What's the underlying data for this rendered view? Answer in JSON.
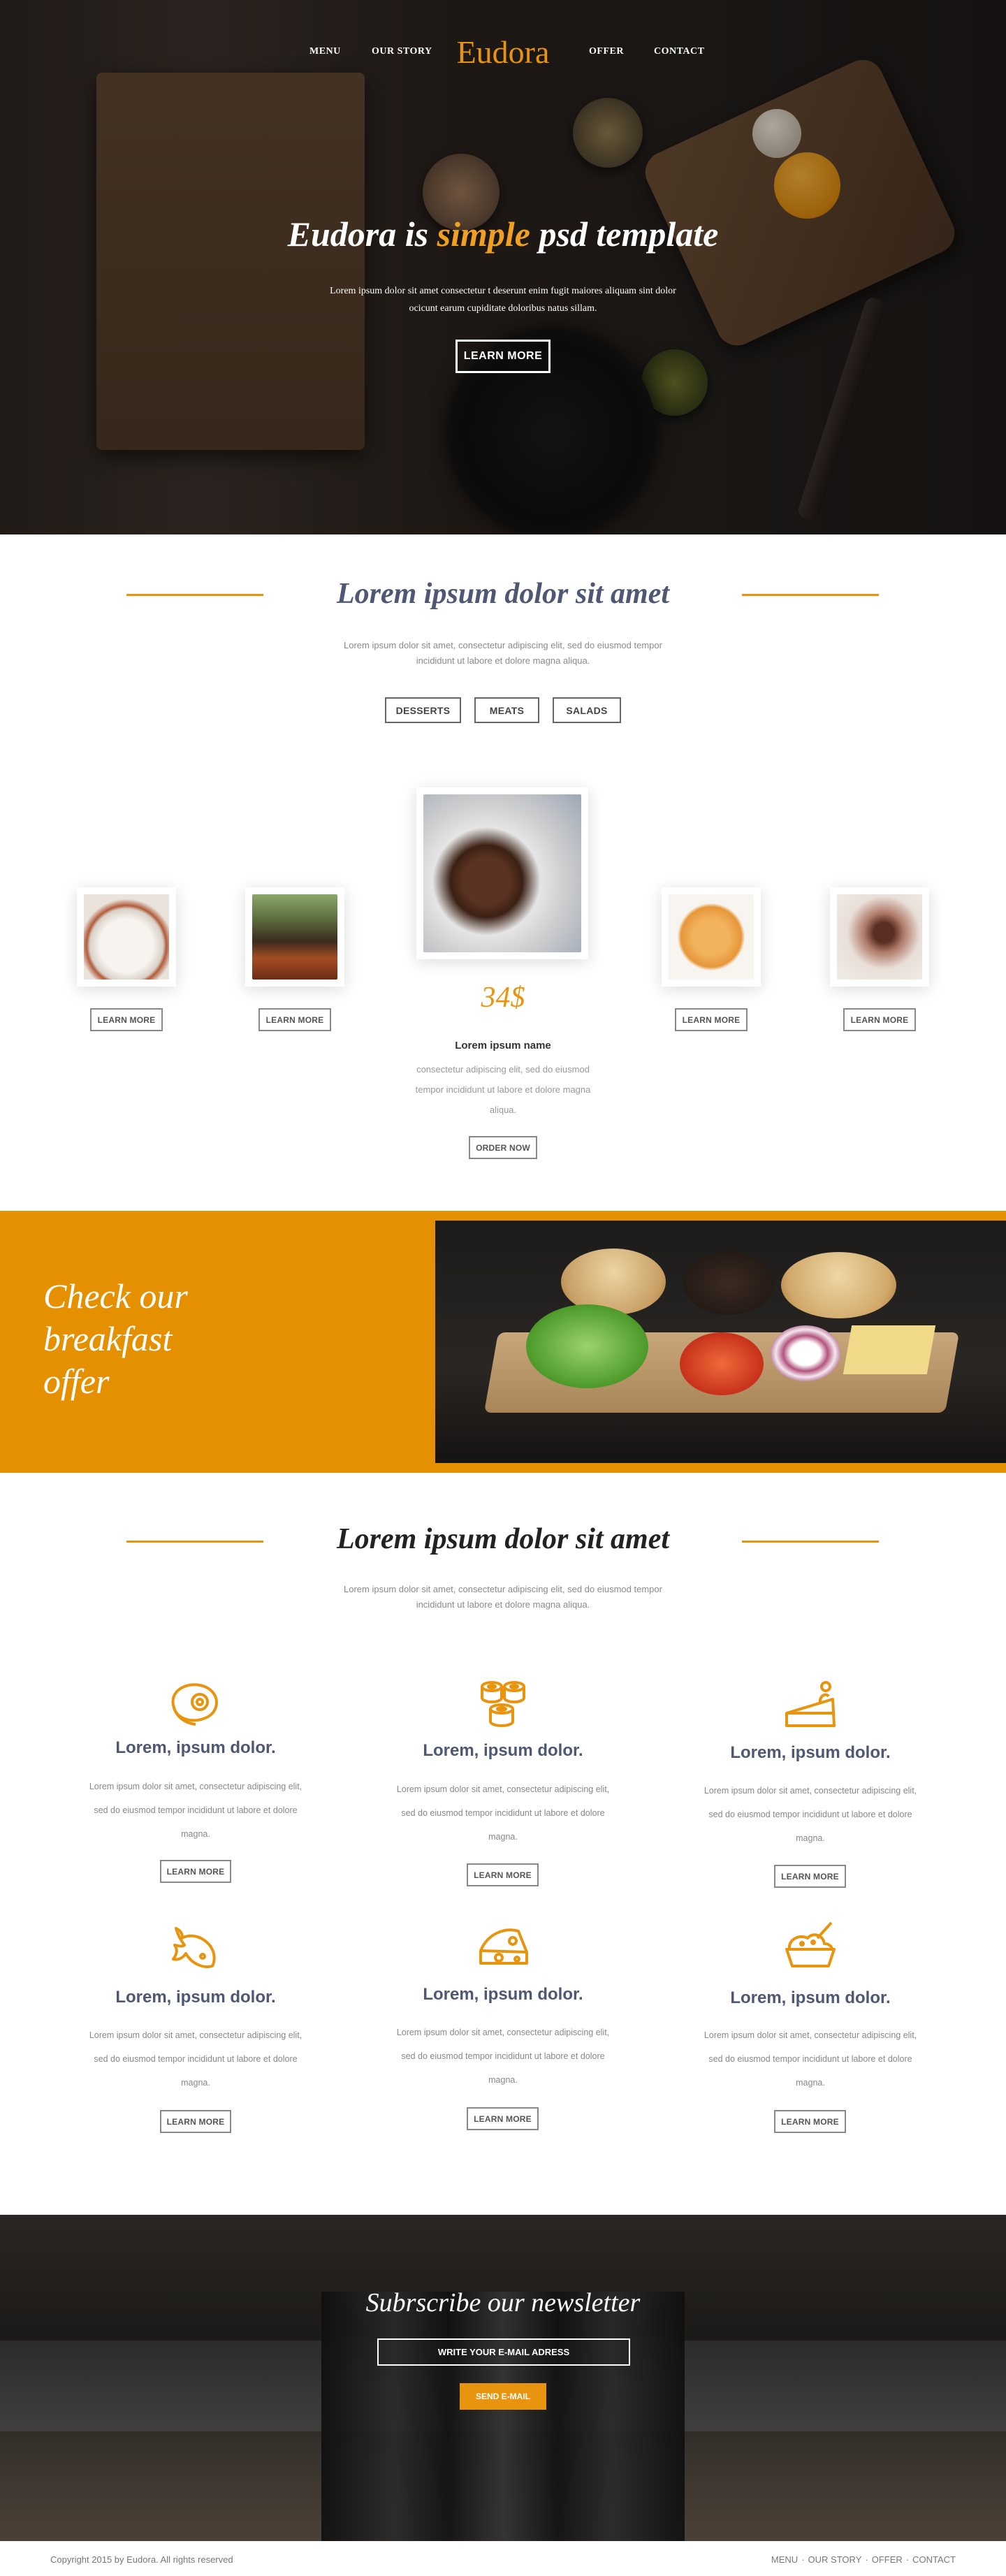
{
  "nav": {
    "menu": "MENU",
    "our_story": "OUR STORY",
    "logo": "Eudora",
    "offer": "OFFER",
    "contact": "CONTACT"
  },
  "hero": {
    "title_before": "Eudora is ",
    "title_highlight": "simple",
    "title_after": " psd template",
    "description": "Lorem ipsum dolor sit amet consectetur t deserunt enim fugit maiores aliquam sint dolor ocicunt earum cupiditate doloribus natus sillam.",
    "button": "LEARN MORE"
  },
  "section1": {
    "title": "Lorem ipsum dolor sit amet",
    "description": "Lorem ipsum dolor sit amet, consectetur adipiscing elit, sed do eiusmod tempor incididunt ut labore et dolore magna aliqua.",
    "tabs": [
      "DESSERTS",
      "MEATS",
      "SALADS"
    ],
    "card_button": "LEARN MORE",
    "featured": {
      "price": "34$",
      "name": "Lorem ipsum name",
      "description": "consectetur adipiscing elit, sed do eiusmod tempor incididunt ut labore et dolore magna aliqua.",
      "button": "ORDER NOW"
    }
  },
  "breakfast": {
    "text": "Check our breakfast offer"
  },
  "section2": {
    "title": "Lorem ipsum dolor sit amet",
    "description": "Lorem ipsum dolor sit amet, consectetur adipiscing elit, sed do eiusmod tempor incididunt ut labore et dolore magna aliqua.",
    "feature_title": "Lorem, ipsum dolor.",
    "feature_desc": "Lorem ipsum dolor sit amet, consectetur adipiscing elit, sed do eiusmod tempor incididunt ut labore et dolore magna.",
    "button": "LEARN MORE",
    "icons": [
      "steak-icon",
      "sushi-icon",
      "cake-icon",
      "fish-icon",
      "cheese-icon",
      "dessert-icon"
    ]
  },
  "newsletter": {
    "title": "Subrscribe our newsletter",
    "placeholder": "WRITE YOUR E-MAIL ADRESS",
    "button": "SEND E-MAIL"
  },
  "footer": {
    "copyright": "Copyright 2015 by Eudora. All rights reserved",
    "links": [
      "MENU",
      "·",
      "OUR STORY",
      "·",
      "OFFER",
      "·",
      "CONTACT"
    ]
  },
  "colors": {
    "accent": "#e8940f",
    "heading_blue": "#4e5874"
  }
}
